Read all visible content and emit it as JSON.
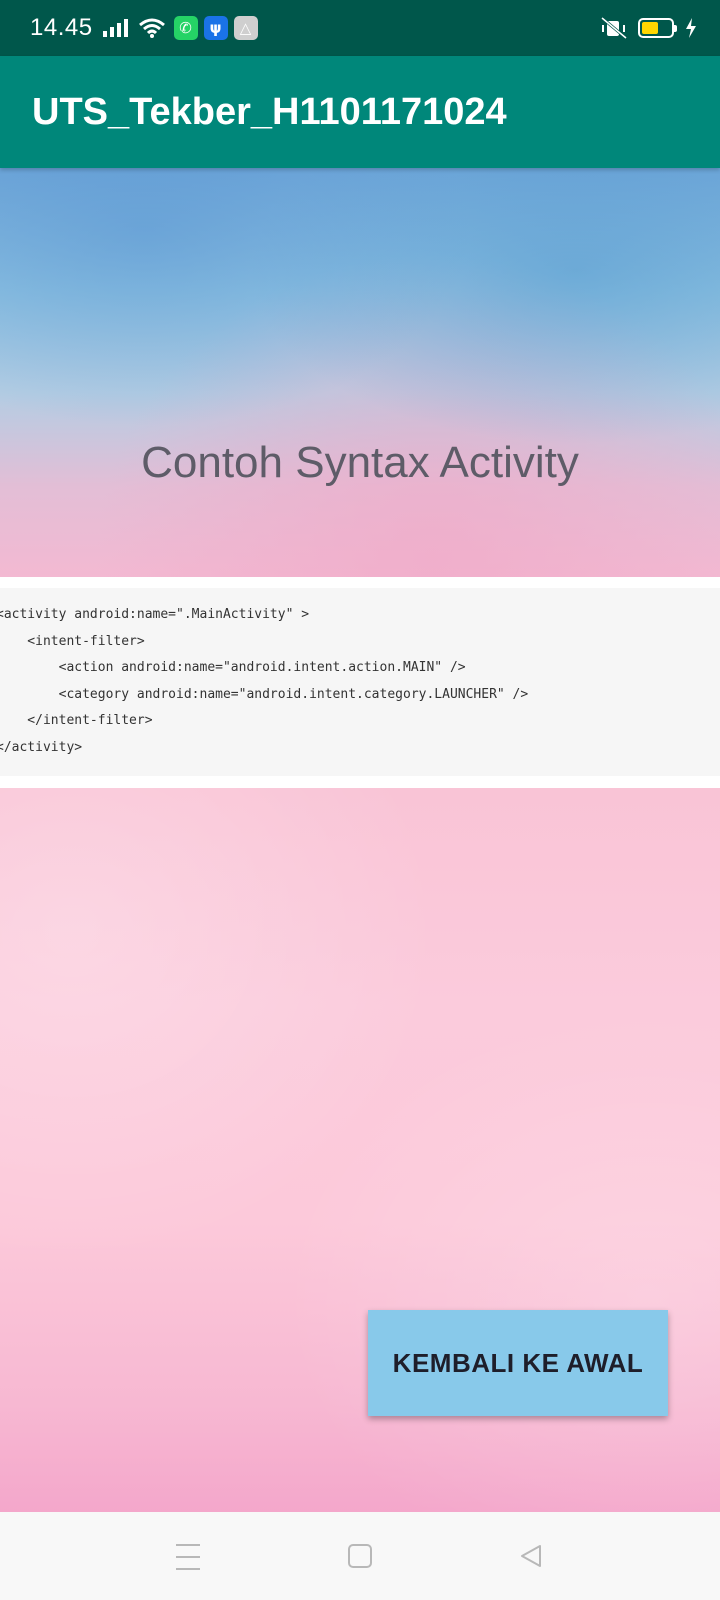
{
  "status_bar": {
    "time": "14.45",
    "icons": [
      "signal-icon",
      "wifi-icon",
      "whatsapp-icon",
      "usb-icon",
      "drive-icon",
      "vibrate-icon",
      "battery-icon",
      "charging-icon"
    ],
    "battery_level": 0.45,
    "battery_color": "#ffd600"
  },
  "app_bar": {
    "title": "UTS_Tekber_H1101171024",
    "color": "#00877a"
  },
  "header": {
    "title": "Contoh Syntax Activity"
  },
  "code": {
    "lines": [
      "<activity android:name=\".MainActivity\" >",
      "    <intent-filter>",
      "        <action android:name=\"android.intent.action.MAIN\" />",
      "        <category android:name=\"android.intent.category.LAUNCHER\" />",
      "    </intent-filter>",
      "</activity>"
    ]
  },
  "action_button": {
    "label": "KEMBALI KE AWAL",
    "color": "#88c9ea"
  },
  "nav_bar": {
    "icons": [
      "menu-icon",
      "home-icon",
      "back-icon"
    ]
  }
}
